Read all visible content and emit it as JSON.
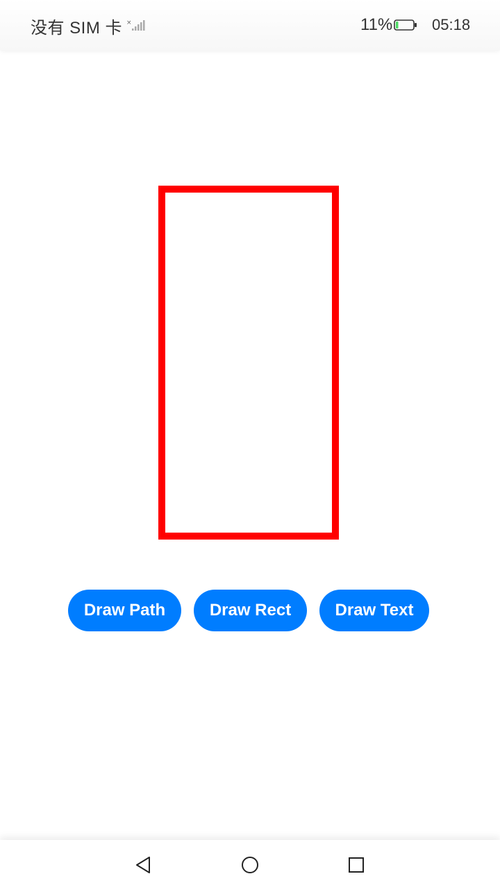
{
  "status_bar": {
    "carrier": "没有 SIM 卡",
    "battery_percent": "11%",
    "battery_level": 0.11,
    "time": "05:18",
    "icons": [
      "signal-icon",
      "battery-icon"
    ]
  },
  "canvas": {
    "shape": "rectangle",
    "stroke_color": "#ff0000"
  },
  "buttons": {
    "draw_path": "Draw Path",
    "draw_rect": "Draw Rect",
    "draw_text": "Draw Text",
    "color": "#007dff"
  },
  "nav_bar": {
    "icons": [
      "back-icon",
      "home-icon",
      "recent-apps-icon"
    ]
  }
}
